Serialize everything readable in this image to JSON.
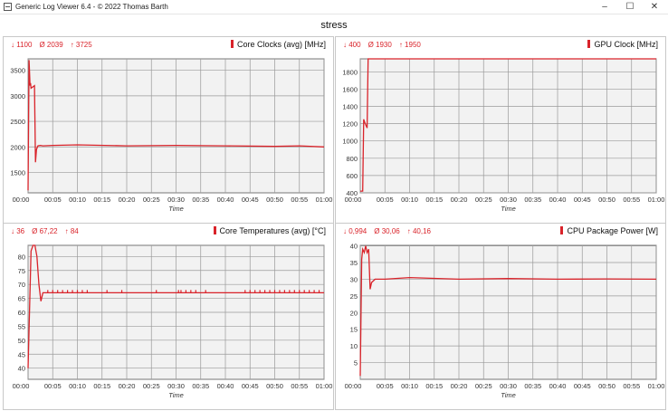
{
  "window": {
    "title": "Generic Log Viewer 6.4 - © 2022 Thomas Barth",
    "minimize_icon": "minimize-icon",
    "maximize_icon": "maximize-icon",
    "close_icon": "close-icon"
  },
  "document_title": "stress",
  "colors": {
    "series": "#d9232a",
    "plot_bg": "#f2f2f2",
    "grid": "#9a9a9a"
  },
  "chart_data": [
    {
      "type": "line",
      "title": "Core Clocks (avg) [MHz]",
      "xlabel": "Time",
      "stats": {
        "min": "↓ 1100",
        "avg": "Ø 2039",
        "max": "↑ 3725"
      },
      "ylim": [
        1100,
        3725
      ],
      "yticks": [
        1500,
        2000,
        2500,
        3000,
        3500
      ],
      "xticks": [
        "00:00",
        "00:05",
        "00:10",
        "00:15",
        "00:20",
        "00:25",
        "00:30",
        "00:35",
        "00:40",
        "00:45",
        "00:50",
        "00:55",
        "01:00"
      ],
      "x": [
        0,
        0.2,
        0.4,
        0.5,
        0.6,
        1.3,
        1.5,
        1.7,
        2.0,
        2.5,
        3,
        5,
        10,
        20,
        30,
        40,
        50,
        55,
        60
      ],
      "values": [
        1150,
        3700,
        3200,
        3250,
        3150,
        3200,
        1700,
        1950,
        2020,
        2030,
        2020,
        2030,
        2040,
        2020,
        2030,
        2020,
        2010,
        2020,
        2000
      ],
      "grid": true
    },
    {
      "type": "line",
      "title": "GPU Clock [MHz]",
      "xlabel": "Time",
      "stats": {
        "min": "↓ 400",
        "avg": "Ø 1930",
        "max": "↑ 1950"
      },
      "ylim": [
        400,
        1950
      ],
      "yticks": [
        400,
        600,
        800,
        1000,
        1200,
        1400,
        1600,
        1800
      ],
      "xticks": [
        "00:00",
        "00:05",
        "00:10",
        "00:15",
        "00:20",
        "00:25",
        "00:30",
        "00:35",
        "00:40",
        "00:45",
        "00:50",
        "00:55",
        "01:00"
      ],
      "x": [
        0,
        0.5,
        0.7,
        1.0,
        1.4,
        1.6,
        1.8,
        60
      ],
      "values": [
        420,
        420,
        1250,
        1200,
        1150,
        1950,
        1950,
        1950
      ],
      "grid": true
    },
    {
      "type": "line",
      "title": "Core Temperatures (avg) [°C]",
      "xlabel": "Time",
      "stats": {
        "min": "↓ 36",
        "avg": "Ø 67,22",
        "max": "↑ 84"
      },
      "ylim": [
        36,
        84
      ],
      "yticks": [
        40,
        45,
        50,
        55,
        60,
        65,
        70,
        75,
        80
      ],
      "xticks": [
        "00:00",
        "00:05",
        "00:10",
        "00:15",
        "00:20",
        "00:25",
        "00:30",
        "00:35",
        "00:40",
        "00:45",
        "00:50",
        "00:55",
        "01:00"
      ],
      "x": [
        0,
        0.6,
        1.0,
        1.4,
        1.8,
        2.2,
        2.6,
        3.0,
        60
      ],
      "values": [
        40,
        82,
        84,
        84,
        80,
        70,
        64,
        67,
        67
      ],
      "spikes_at": [
        4,
        5,
        6,
        7,
        8,
        9,
        10,
        11,
        12,
        16,
        19,
        26,
        30.5,
        31,
        32,
        33,
        34,
        36,
        44,
        45,
        46,
        47,
        48,
        49,
        50,
        51,
        52,
        53,
        54,
        55,
        56,
        57,
        58,
        59
      ],
      "spike_value": 68,
      "grid": true
    },
    {
      "type": "line",
      "title": "CPU Package Power [W]",
      "xlabel": "Time",
      "stats": {
        "min": "↓ 0,994",
        "avg": "Ø 30,06",
        "max": "↑ 40,16"
      },
      "ylim": [
        0,
        40.16
      ],
      "yticks": [
        5,
        10,
        15,
        20,
        25,
        30,
        35,
        40
      ],
      "xticks": [
        "00:00",
        "00:05",
        "00:10",
        "00:15",
        "00:20",
        "00:25",
        "00:30",
        "00:35",
        "00:40",
        "00:45",
        "00:50",
        "00:55",
        "01:00"
      ],
      "x": [
        0,
        0.3,
        0.5,
        0.8,
        1.1,
        1.4,
        1.7,
        2.0,
        2.3,
        3,
        5,
        10,
        20,
        30,
        40,
        50,
        60
      ],
      "values": [
        1.0,
        36,
        39,
        38,
        40,
        38,
        39,
        27,
        29,
        30,
        30,
        30.5,
        30,
        30.2,
        30,
        30.1,
        30
      ],
      "grid": true
    }
  ]
}
